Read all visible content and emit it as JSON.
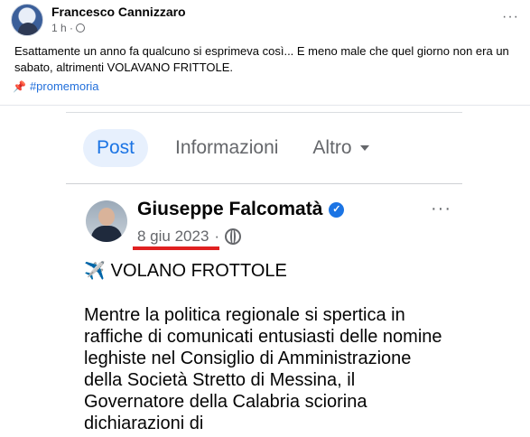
{
  "post": {
    "author": "Francesco Cannizzaro",
    "time": "1 h ·",
    "more": "···",
    "text": "Esattamente un anno fa qualcuno si esprimeva così... E meno male che quel giorno non era un sabato, altrimenti VOLAVANO FRITTOLE.",
    "pin_icon": "📌",
    "hashtag": "#promemoria"
  },
  "screenshot": {
    "tabs": [
      {
        "label": "Post"
      },
      {
        "label": "Informazioni"
      },
      {
        "label": "Altro"
      }
    ],
    "author": "Giuseppe Falcomatà",
    "verified_icon": "✓",
    "date": "8 giu 2023",
    "date_sep": "·",
    "more": "···",
    "headline_icon": "✈️",
    "headline": "VOLANO FROTTOLE",
    "body": "Mentre la politica regionale si spertica in raffiche di comunicati entusiasti delle nomine leghiste nel Consiglio di Amministrazione della Società Stretto di Messina, il Governatore della Calabria sciorina dichiarazioni di"
  },
  "colors": {
    "accent": "#1b74e4",
    "hashtag": "#216fdb",
    "underline": "#e02020"
  }
}
